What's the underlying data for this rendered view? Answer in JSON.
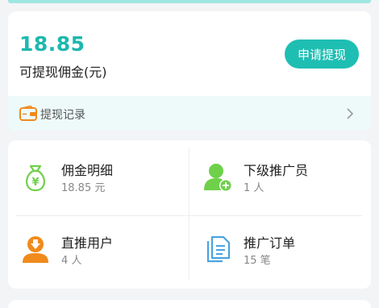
{
  "balance": {
    "amount": "18.85",
    "label": "可提现佣金(元)",
    "withdraw_button": "申请提现"
  },
  "withdraw_record": {
    "label": "提现记录"
  },
  "tiles": [
    {
      "title": "佣金明细",
      "value": "18.85 元",
      "icon": "money-bag-icon"
    },
    {
      "title": "下级推广员",
      "value": "1 人",
      "icon": "user-add-icon"
    },
    {
      "title": "直推用户",
      "value": "4 人",
      "icon": "user-download-icon"
    },
    {
      "title": "推广订单",
      "value": "15 笔",
      "icon": "documents-icon"
    }
  ],
  "colors": {
    "accent": "#1ebeb3",
    "amount": "#1db8ae",
    "green": "#6fd04a",
    "orange": "#f08a1c",
    "blue": "#4aa3e0"
  }
}
